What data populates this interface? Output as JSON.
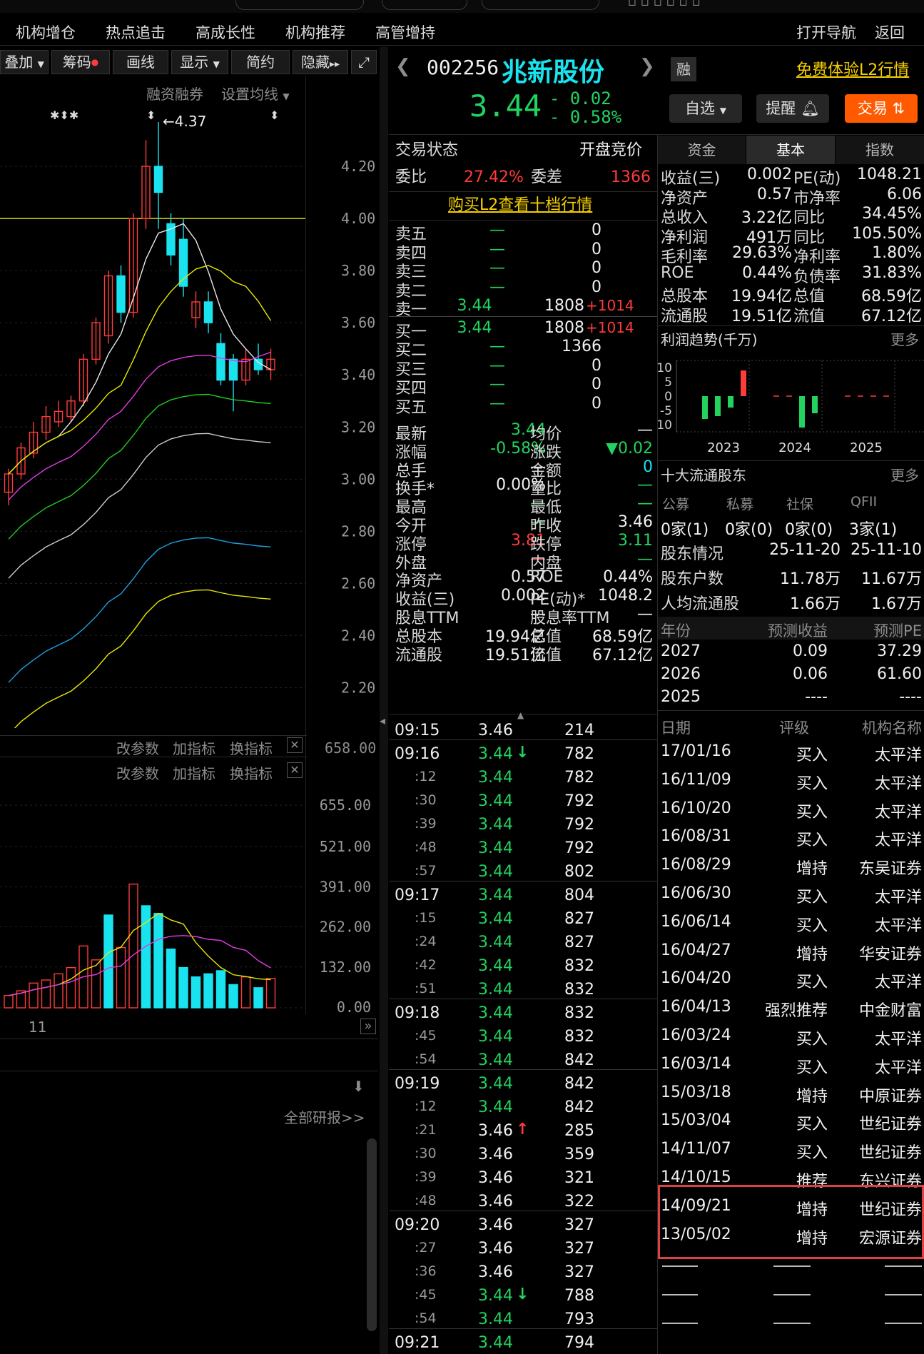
{
  "top_nav": [
    "机构增仓",
    "热点追击",
    "高成长性",
    "机构推荐",
    "高管增持"
  ],
  "top_right_nav": [
    "打开导航",
    "返回"
  ],
  "chart_toolbar": [
    "叠加",
    "筹码",
    "画线",
    "显示",
    "简约",
    "隐藏"
  ],
  "chart_options": {
    "margin_trading": "融资融券",
    "ma_setting": "设置均线"
  },
  "main_chart": {
    "high_label": "4.37",
    "y_ticks": [
      "4.20",
      "4.00",
      "3.80",
      "3.60",
      "3.40",
      "3.20",
      "3.00",
      "2.80",
      "2.60",
      "2.40",
      "2.20"
    ],
    "ref_line": 4.0,
    "candles": [
      {
        "o": 2.95,
        "c": 3.02,
        "h": 3.04,
        "l": 2.9
      },
      {
        "o": 3.02,
        "c": 3.12,
        "h": 3.14,
        "l": 3.0
      },
      {
        "o": 3.1,
        "c": 3.18,
        "h": 3.22,
        "l": 3.08
      },
      {
        "o": 3.18,
        "c": 3.24,
        "h": 3.28,
        "l": 3.15
      },
      {
        "o": 3.22,
        "c": 3.26,
        "h": 3.3,
        "l": 3.2
      },
      {
        "o": 3.24,
        "c": 3.3,
        "h": 3.32,
        "l": 3.22
      },
      {
        "o": 3.3,
        "c": 3.46,
        "h": 3.48,
        "l": 3.28
      },
      {
        "o": 3.46,
        "c": 3.6,
        "h": 3.62,
        "l": 3.44
      },
      {
        "o": 3.55,
        "c": 3.78,
        "h": 3.8,
        "l": 3.52
      },
      {
        "o": 3.78,
        "c": 3.64,
        "h": 3.82,
        "l": 3.6
      },
      {
        "o": 3.64,
        "c": 4.0,
        "h": 4.02,
        "l": 3.62
      },
      {
        "o": 4.0,
        "c": 4.2,
        "h": 4.3,
        "l": 3.96
      },
      {
        "o": 4.2,
        "c": 4.1,
        "h": 4.37,
        "l": 3.96
      },
      {
        "o": 3.98,
        "c": 3.86,
        "h": 4.02,
        "l": 3.82
      },
      {
        "o": 3.92,
        "c": 3.74,
        "h": 4.0,
        "l": 3.7
      },
      {
        "o": 3.62,
        "c": 3.68,
        "h": 3.72,
        "l": 3.58
      },
      {
        "o": 3.68,
        "c": 3.6,
        "h": 3.72,
        "l": 3.56
      },
      {
        "o": 3.52,
        "c": 3.38,
        "h": 3.56,
        "l": 3.36
      },
      {
        "o": 3.46,
        "c": 3.38,
        "h": 3.48,
        "l": 3.26
      },
      {
        "o": 3.38,
        "c": 3.46,
        "h": 3.5,
        "l": 3.36
      },
      {
        "o": 3.46,
        "c": 3.42,
        "h": 3.52,
        "l": 3.4
      },
      {
        "o": 3.42,
        "c": 3.46,
        "h": 3.5,
        "l": 3.38
      }
    ]
  },
  "indicator_panel_1": {
    "params": "改参数",
    "add": "加指标",
    "switch": "换指标",
    "value": "658.00"
  },
  "volume_panel": {
    "params": "改参数",
    "add": "加指标",
    "switch": "换指标",
    "y_ticks": [
      "655.00",
      "521.00",
      "391.00",
      "262.00",
      "132.00",
      "0.00"
    ],
    "x_label": "11",
    "bars": [
      {
        "v": 40,
        "up": true
      },
      {
        "v": 55,
        "up": true
      },
      {
        "v": 80,
        "up": true
      },
      {
        "v": 90,
        "up": true
      },
      {
        "v": 110,
        "up": true
      },
      {
        "v": 130,
        "up": true
      },
      {
        "v": 200,
        "up": true
      },
      {
        "v": 155,
        "up": true
      },
      {
        "v": 300,
        "up": false
      },
      {
        "v": 195,
        "up": true
      },
      {
        "v": 400,
        "up": true
      },
      {
        "v": 330,
        "up": false
      },
      {
        "v": 305,
        "up": false
      },
      {
        "v": 190,
        "up": false
      },
      {
        "v": 130,
        "up": false
      },
      {
        "v": 100,
        "up": false
      },
      {
        "v": 110,
        "up": false
      },
      {
        "v": 120,
        "up": false
      },
      {
        "v": 75,
        "up": false
      },
      {
        "v": 100,
        "up": true
      },
      {
        "v": 65,
        "up": false
      },
      {
        "v": 95,
        "up": true
      }
    ]
  },
  "research": {
    "all_reports": "全部研报>>"
  },
  "stock": {
    "code": "002256",
    "name": "兆新股份",
    "margin_tag": "融",
    "l2_promo": "免费体验L2行情",
    "price": "3.44",
    "change": "- 0.02",
    "change_pct": "- 0.58%",
    "buttons": {
      "watchlist": "自选",
      "alert": "提醒",
      "trade": "交易"
    }
  },
  "quote_header": {
    "status_label": "交易状态",
    "status_value": "开盘竞价",
    "ratio_label": "委比",
    "ratio_value": "27.42%",
    "diff_label": "委差",
    "diff_value": "1366",
    "l2_link": "购买L2查看十档行情"
  },
  "order_book": {
    "asks": [
      {
        "label": "卖五",
        "price": "—",
        "vol": "0",
        "delta": ""
      },
      {
        "label": "卖四",
        "price": "—",
        "vol": "0",
        "delta": ""
      },
      {
        "label": "卖三",
        "price": "—",
        "vol": "0",
        "delta": ""
      },
      {
        "label": "卖二",
        "price": "—",
        "vol": "0",
        "delta": ""
      },
      {
        "label": "卖一",
        "price": "3.44",
        "vol": "1808",
        "delta": "+1014"
      }
    ],
    "bids": [
      {
        "label": "买一",
        "price": "3.44",
        "vol": "1808",
        "delta": "+1014"
      },
      {
        "label": "买二",
        "price": "—",
        "vol": "1366",
        "delta": ""
      },
      {
        "label": "买三",
        "price": "—",
        "vol": "0",
        "delta": ""
      },
      {
        "label": "买四",
        "price": "—",
        "vol": "0",
        "delta": ""
      },
      {
        "label": "买五",
        "price": "—",
        "vol": "0",
        "delta": ""
      }
    ]
  },
  "stats": [
    {
      "l1": "最新",
      "v1": "3.44",
      "c1": "green",
      "l2": "均价",
      "v2": "—",
      "c2": "white"
    },
    {
      "l1": "涨幅",
      "v1": "-0.58%",
      "c1": "green",
      "l2": "涨跌",
      "v2": "▼0.02",
      "c2": "green"
    },
    {
      "l1": "总手",
      "v1": "—",
      "c1": "white",
      "l2": "金额",
      "v2": "0",
      "c2": "cyan"
    },
    {
      "l1": "换手*",
      "v1": "0.00%",
      "c1": "white",
      "l2": "量比",
      "v2": "—",
      "c2": "green"
    },
    {
      "l1": "最高",
      "v1": "—",
      "c1": "green",
      "l2": "最低",
      "v2": "—",
      "c2": "green"
    },
    {
      "l1": "今开",
      "v1": "—",
      "c1": "green",
      "l2": "昨收",
      "v2": "3.46",
      "c2": "white"
    },
    {
      "l1": "涨停",
      "v1": "3.81",
      "c1": "red",
      "l2": "跌停",
      "v2": "3.11",
      "c2": "green"
    },
    {
      "l1": "外盘",
      "v1": "—",
      "c1": "red",
      "l2": "内盘",
      "v2": "—",
      "c2": "green"
    },
    {
      "l1": "净资产",
      "v1": "0.57",
      "c1": "white",
      "l2": "ROE",
      "v2": "0.44%",
      "c2": "white"
    },
    {
      "l1": "收益(三)",
      "v1": "0.002",
      "c1": "white",
      "l2": "PE(动)*",
      "v2": "1048.2",
      "c2": "white"
    },
    {
      "l1": "股息TTM",
      "v1": "—",
      "c1": "white",
      "l2": "股息率TTM",
      "v2": "—",
      "c2": "white"
    },
    {
      "l1": "总股本",
      "v1": "19.94亿",
      "c1": "white",
      "l2": "总值",
      "v2": "68.59亿",
      "c2": "white"
    },
    {
      "l1": "流通股",
      "v1": "19.51亿",
      "c1": "white",
      "l2": "流值",
      "v2": "67.12亿",
      "c2": "white"
    }
  ],
  "ticks": [
    {
      "t": "09:15",
      "p": "3.46",
      "v": "214",
      "pc": "white",
      "arrow": "",
      "major": true
    },
    {
      "t": "09:16",
      "p": "3.44",
      "v": "782",
      "pc": "green",
      "arrow": "down",
      "major": true
    },
    {
      "t": ":12",
      "p": "3.44",
      "v": "782",
      "pc": "green",
      "arrow": "",
      "major": false
    },
    {
      "t": ":30",
      "p": "3.44",
      "v": "792",
      "pc": "green",
      "arrow": "",
      "major": false
    },
    {
      "t": ":39",
      "p": "3.44",
      "v": "792",
      "pc": "green",
      "arrow": "",
      "major": false
    },
    {
      "t": ":48",
      "p": "3.44",
      "v": "792",
      "pc": "green",
      "arrow": "",
      "major": false
    },
    {
      "t": ":57",
      "p": "3.44",
      "v": "802",
      "pc": "green",
      "arrow": "",
      "major": false
    },
    {
      "t": "09:17",
      "p": "3.44",
      "v": "804",
      "pc": "green",
      "arrow": "",
      "major": true
    },
    {
      "t": ":15",
      "p": "3.44",
      "v": "827",
      "pc": "green",
      "arrow": "",
      "major": false
    },
    {
      "t": ":24",
      "p": "3.44",
      "v": "827",
      "pc": "green",
      "arrow": "",
      "major": false
    },
    {
      "t": ":42",
      "p": "3.44",
      "v": "832",
      "pc": "green",
      "arrow": "",
      "major": false
    },
    {
      "t": ":51",
      "p": "3.44",
      "v": "832",
      "pc": "green",
      "arrow": "",
      "major": false
    },
    {
      "t": "09:18",
      "p": "3.44",
      "v": "832",
      "pc": "green",
      "arrow": "",
      "major": true
    },
    {
      "t": ":45",
      "p": "3.44",
      "v": "832",
      "pc": "green",
      "arrow": "",
      "major": false
    },
    {
      "t": ":54",
      "p": "3.44",
      "v": "842",
      "pc": "green",
      "arrow": "",
      "major": false
    },
    {
      "t": "09:19",
      "p": "3.44",
      "v": "842",
      "pc": "green",
      "arrow": "",
      "major": true
    },
    {
      "t": ":12",
      "p": "3.44",
      "v": "842",
      "pc": "green",
      "arrow": "",
      "major": false
    },
    {
      "t": ":21",
      "p": "3.46",
      "v": "285",
      "pc": "white",
      "arrow": "up",
      "major": false
    },
    {
      "t": ":30",
      "p": "3.46",
      "v": "359",
      "pc": "white",
      "arrow": "",
      "major": false
    },
    {
      "t": ":39",
      "p": "3.46",
      "v": "321",
      "pc": "white",
      "arrow": "",
      "major": false
    },
    {
      "t": ":48",
      "p": "3.46",
      "v": "322",
      "pc": "white",
      "arrow": "",
      "major": false
    },
    {
      "t": "09:20",
      "p": "3.46",
      "v": "327",
      "pc": "white",
      "arrow": "",
      "major": true
    },
    {
      "t": ":27",
      "p": "3.46",
      "v": "327",
      "pc": "white",
      "arrow": "",
      "major": false
    },
    {
      "t": ":36",
      "p": "3.46",
      "v": "327",
      "pc": "white",
      "arrow": "",
      "major": false
    },
    {
      "t": ":45",
      "p": "3.44",
      "v": "788",
      "pc": "green",
      "arrow": "down",
      "major": false
    },
    {
      "t": ":54",
      "p": "3.44",
      "v": "793",
      "pc": "green",
      "arrow": "",
      "major": false
    },
    {
      "t": "09:21",
      "p": "3.44",
      "v": "794",
      "pc": "green",
      "arrow": "",
      "major": true
    }
  ],
  "info_tabs": [
    "资金",
    "基本",
    "指数"
  ],
  "fundamentals": [
    {
      "l1": "收益(三)",
      "v1": "0.002",
      "l2": "PE(动)",
      "v2": "1048.21"
    },
    {
      "l1": "净资产",
      "v1": "0.57",
      "l2": "市净率",
      "v2": "6.06"
    },
    {
      "l1": "总收入",
      "v1": "3.22亿",
      "l2": "同比",
      "v2": "34.45%"
    },
    {
      "l1": "净利润",
      "v1": "491万",
      "l2": "同比",
      "v2": "105.50%"
    },
    {
      "l1": "毛利率",
      "v1": "29.63%",
      "l2": "净利率",
      "v2": "1.80%"
    },
    {
      "l1": "ROE",
      "v1": "0.44%",
      "l2": "负债率",
      "v2": "31.83%"
    },
    {
      "l1": "总股本",
      "v1": "19.94亿",
      "l2": "总值",
      "v2": "68.59亿"
    },
    {
      "l1": "流通股",
      "v1": "19.51亿",
      "l2": "流值",
      "v2": "67.12亿"
    }
  ],
  "profit_trend": {
    "title": "利润趋势(千万)",
    "more": "更多",
    "y_ticks": [
      "10",
      "5",
      "0",
      "-5",
      "10"
    ],
    "years": [
      "2023",
      "2024",
      "2025"
    ],
    "chart_data": {
      "type": "bar",
      "x": [
        "2023Q1",
        "2023Q2",
        "2023Q3",
        "2023Q4",
        "2024Q1",
        "2024Q2",
        "2024Q3",
        "2024Q4",
        "2025Q1",
        "2025Q2",
        "2025Q3",
        "2025Q4"
      ],
      "values": [
        -8,
        -7,
        -4,
        9,
        0.2,
        0.2,
        -11,
        -6,
        0.2,
        0.2,
        0.2,
        0
      ],
      "ylim": [
        -11,
        10
      ]
    }
  },
  "shareholders": {
    "title": "十大流通股东",
    "more": "更多",
    "headers": [
      "公募",
      "私募",
      "社保",
      "QFII"
    ],
    "counts": [
      "0家(1)",
      "0家(0)",
      "0家(0)",
      "3家(1)"
    ],
    "rows": [
      {
        "label": "股东情况",
        "a": "25-11-20",
        "b": "25-11-10"
      },
      {
        "label": "股东户数",
        "a": "11.78万",
        "b": "11.67万"
      },
      {
        "label": "人均流通股",
        "a": "1.66万",
        "b": "1.67万"
      }
    ]
  },
  "forecast": {
    "headers": [
      "年份",
      "预测收益",
      "预测PE"
    ],
    "rows": [
      {
        "y": "2027",
        "e": "0.09",
        "pe": "37.29"
      },
      {
        "y": "2026",
        "e": "0.06",
        "pe": "61.60"
      },
      {
        "y": "2025",
        "e": "----",
        "pe": "----"
      }
    ]
  },
  "ratings": {
    "headers": [
      "日期",
      "评级",
      "机构名称"
    ],
    "rows": [
      {
        "d": "17/01/16",
        "r": "买入",
        "o": "太平洋"
      },
      {
        "d": "16/11/09",
        "r": "买入",
        "o": "太平洋"
      },
      {
        "d": "16/10/20",
        "r": "买入",
        "o": "太平洋"
      },
      {
        "d": "16/08/31",
        "r": "买入",
        "o": "太平洋"
      },
      {
        "d": "16/08/29",
        "r": "增持",
        "o": "东吴证券"
      },
      {
        "d": "16/06/30",
        "r": "买入",
        "o": "太平洋"
      },
      {
        "d": "16/06/14",
        "r": "买入",
        "o": "太平洋"
      },
      {
        "d": "16/04/27",
        "r": "增持",
        "o": "华安证券"
      },
      {
        "d": "16/04/20",
        "r": "买入",
        "o": "太平洋"
      },
      {
        "d": "16/04/13",
        "r": "强烈推荐",
        "o": "中金财富"
      },
      {
        "d": "16/03/24",
        "r": "买入",
        "o": "太平洋"
      },
      {
        "d": "16/03/14",
        "r": "买入",
        "o": "太平洋"
      },
      {
        "d": "15/03/18",
        "r": "增持",
        "o": "中原证券"
      },
      {
        "d": "15/03/04",
        "r": "买入",
        "o": "世纪证券"
      },
      {
        "d": "14/11/07",
        "r": "买入",
        "o": "世纪证券"
      },
      {
        "d": "14/10/15",
        "r": "推荐",
        "o": "东兴证券"
      },
      {
        "d": "14/09/21",
        "r": "增持",
        "o": "世纪证券"
      },
      {
        "d": "13/05/02",
        "r": "增持",
        "o": "宏源证券"
      }
    ]
  },
  "colors": {
    "up": "#ff3b3b",
    "down": "#19e3ef",
    "green": "#22d35f",
    "highlight": "#e04040",
    "trade": "#ff5a00"
  }
}
